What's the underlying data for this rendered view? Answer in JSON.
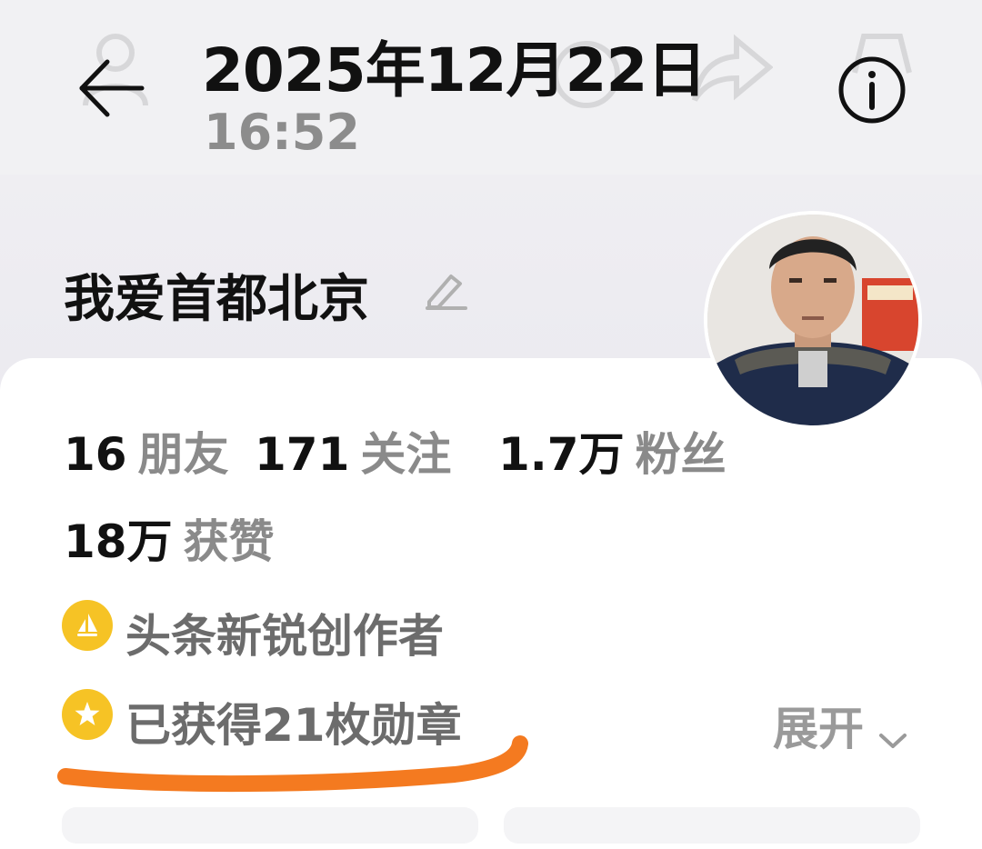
{
  "header": {
    "date_title": "2025年12月22日",
    "time_subtitle": "16:52",
    "back_icon": "arrow-left-icon",
    "info_icon": "info-circle-icon"
  },
  "profile": {
    "username": "我爱首都北京",
    "edit_icon": "pencil-icon",
    "avatar": "user-avatar-photo"
  },
  "stats": [
    {
      "value": "16",
      "label": "朋友"
    },
    {
      "value": "171",
      "label": "关注"
    },
    {
      "value": "1.7万",
      "label": "粉丝"
    },
    {
      "value": "18万",
      "label": "获赞"
    }
  ],
  "badges": [
    {
      "icon": "sailboat-badge-icon",
      "text": "头条新锐创作者"
    },
    {
      "icon": "star-medal-icon",
      "text": "已获得21枚勋章"
    }
  ],
  "expand": {
    "label": "展开",
    "icon": "chevron-down-icon"
  },
  "colors": {
    "badge_gold": "#f6c325",
    "highlight_orange": "#f47a20",
    "muted_text": "#8a8a8a"
  }
}
